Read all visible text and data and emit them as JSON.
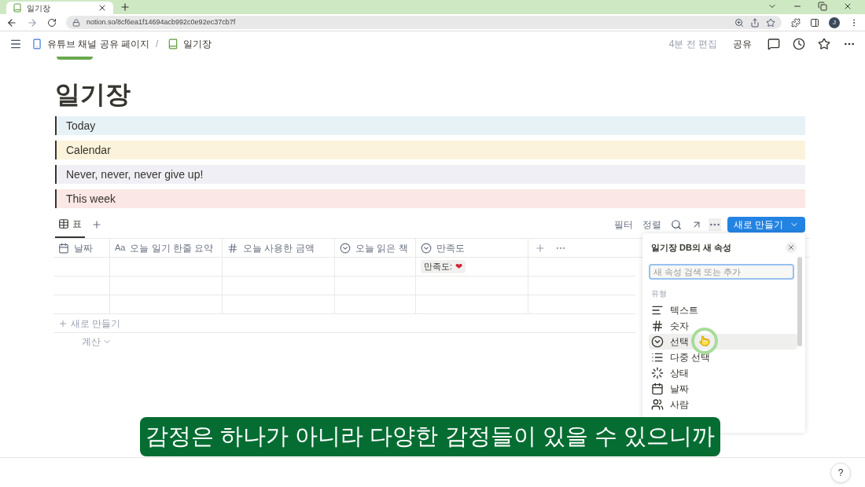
{
  "browser": {
    "tab_title": "일기장",
    "url": "notion.so/8cf6ea1f14694acb992c0e92ec37cb7f",
    "avatar": "J"
  },
  "topbar": {
    "breadcrumbs": [
      {
        "label": "유튜브 채널 공유 페이지",
        "kind": "phone"
      },
      {
        "label": "일기장",
        "kind": "book"
      }
    ],
    "separator": "/",
    "edited": "4분 전 편집",
    "share": "공유"
  },
  "page": {
    "title": "일기장",
    "callouts": [
      {
        "text": "Today",
        "color": "#e7f2f7"
      },
      {
        "text": "Calendar",
        "color": "#fbf3db"
      },
      {
        "text": "Never, never, never give up!",
        "color": "#f1eff6"
      },
      {
        "text": "This week",
        "color": "#fbe7e5"
      }
    ]
  },
  "views": [
    {
      "label": "표",
      "selected": true
    }
  ],
  "toolbar": {
    "filter": "필터",
    "sort": "정렬",
    "new": "새로 만들기"
  },
  "table": {
    "columns": [
      {
        "kind": "date",
        "label": "날짜"
      },
      {
        "kind": "title",
        "icon_text": "Aa",
        "label": "오늘 일기 한줄 요약"
      },
      {
        "kind": "number",
        "label": "오늘 사용한 금액"
      },
      {
        "kind": "select",
        "label": "오늘 읽은 책"
      },
      {
        "kind": "select",
        "label": "만족도"
      }
    ],
    "rows": [
      {
        "kind": "tagged",
        "tag": "만족도:",
        "heart": "❤"
      },
      {
        "kind": "empty"
      },
      {
        "kind": "empty"
      }
    ],
    "add_row": "새로 만들기",
    "calculate": "계산"
  },
  "panel": {
    "title": "일기장 DB의 새 속성",
    "placeholder": "새 속성 검색 또는 추가",
    "section": "유형",
    "items": [
      {
        "kind": "text",
        "label": "텍스트",
        "selected": false
      },
      {
        "kind": "number",
        "label": "숫자",
        "selected": false
      },
      {
        "kind": "select",
        "label": "선택",
        "selected": true
      },
      {
        "kind": "multi",
        "label": "다중 선택",
        "selected": false
      },
      {
        "kind": "status",
        "label": "상태",
        "selected": false
      },
      {
        "kind": "date",
        "label": "날짜",
        "selected": false
      },
      {
        "kind": "person",
        "label": "사람",
        "selected": false
      }
    ]
  },
  "subtitle": "감정은 하나가 아니라 다양한 감정들이 있을 수 있으니까",
  "help": "?"
}
